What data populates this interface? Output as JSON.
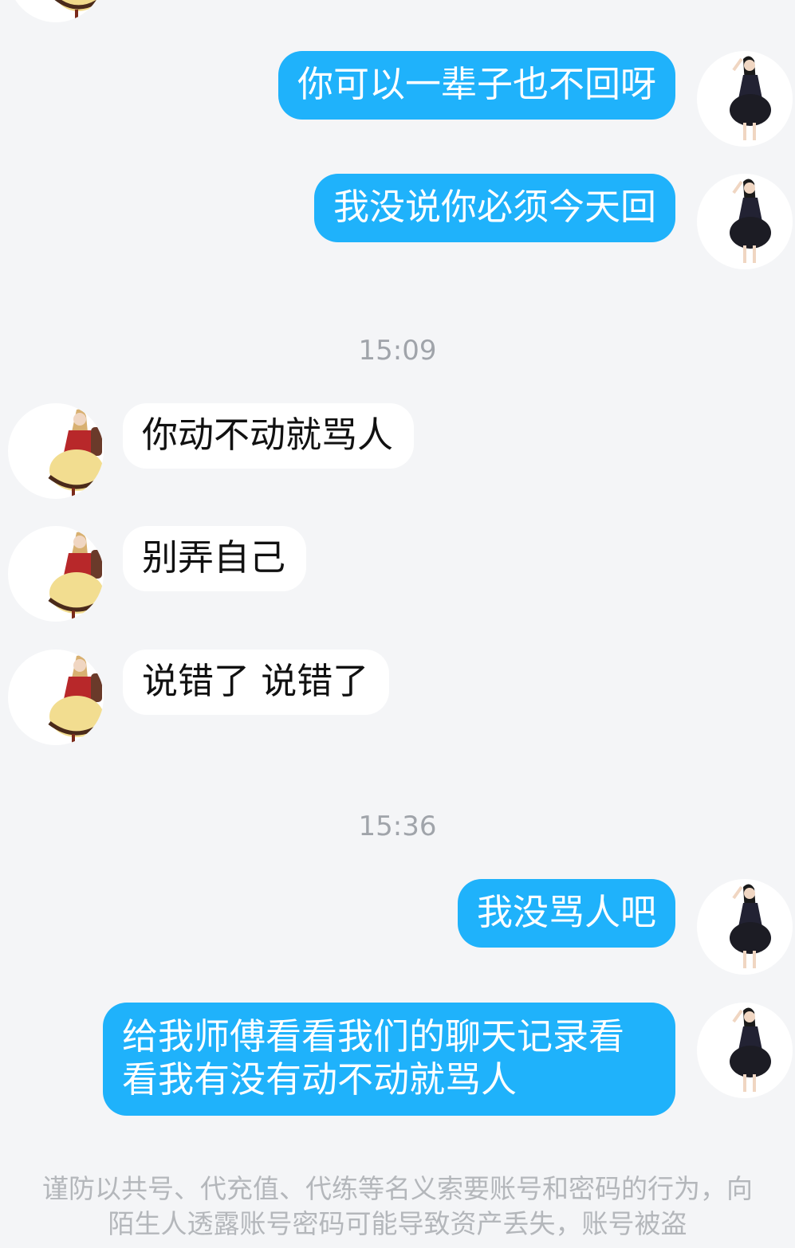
{
  "messages": [
    {
      "side": "out",
      "text": "你可以一辈子也不回呀"
    },
    {
      "side": "out",
      "text": "我没说你必须今天回"
    },
    {
      "side": "in",
      "text": "你动不动就骂人"
    },
    {
      "side": "in",
      "text": "别弄自己"
    },
    {
      "side": "in",
      "text": "说错了 说错了"
    },
    {
      "side": "out",
      "text": "我没骂人吧"
    },
    {
      "side": "out",
      "text": "给我师傅看看我们的聊天记录看看我有没有动不动就骂人"
    }
  ],
  "timestamps": [
    "15:09",
    "15:36"
  ],
  "footer_notice": "谨防以共号、代充值、代练等名义索要账号和密码的行为，向陌生人透露账号密码可能导致资产丢失，账号被盗",
  "colors": {
    "outgoing_bubble": "#1fb2fb",
    "incoming_bubble": "#ffffff",
    "background": "#f4f5f7"
  },
  "icons": {
    "self_avatar": "avatar-girl-black-dress",
    "other_avatar": "avatar-girl-red-dress"
  }
}
